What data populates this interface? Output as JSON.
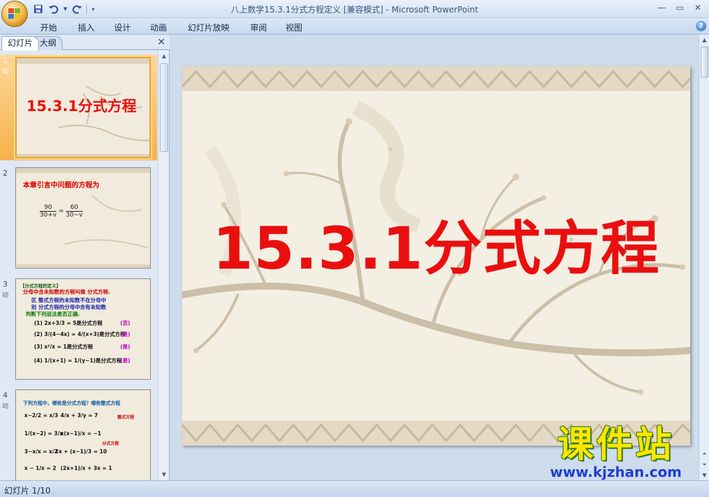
{
  "window": {
    "title": "八上数学15.3.1分式方程定义 [兼容模式]",
    "app_name": "Microsoft PowerPoint",
    "separator": " - "
  },
  "quick_access": {
    "icons": [
      "save-icon",
      "undo-icon",
      "redo-icon",
      "customize-icon"
    ]
  },
  "ribbon": {
    "tabs": [
      "开始",
      "插入",
      "设计",
      "动画",
      "幻灯片放映",
      "审阅",
      "视图"
    ]
  },
  "left_pane": {
    "tabs": [
      "幻灯片",
      "大纲"
    ],
    "close_label": "✕"
  },
  "thumbnails": [
    {
      "number": "1",
      "anim": "动",
      "title": "15.3.1分式方程"
    },
    {
      "number": "2",
      "anim": "",
      "title": "本章引言中问题的方程为",
      "eq_left_num": "90",
      "eq_left_den": "30+v",
      "eq_eq": "=",
      "eq_right_num": "60",
      "eq_right_den": "30−v"
    },
    {
      "number": "3",
      "anim": "动",
      "lines": [
        "【分式方程的定义】",
        "分母中含未知数的方程叫做 分式方程.",
        "区 整式方程的未知数不在分母中",
        "别 分式方程的分母中含有未知数",
        "判断下列说法是否正确.",
        "(1)  2x+3/3 = 5是分式方程",
        "(2)  3/(4−4x) = 4/(x+3)是分式方程",
        "(3)  x²/x = 1是分式方程",
        "(4)  1/(x+1) = 1/(y−1)是分式方程"
      ],
      "answers": [
        "(否)",
        "(是)",
        "(是)",
        "(是)"
      ]
    },
    {
      "number": "4",
      "anim": "动",
      "lines": [
        "下列方程中，哪些是分式方程？哪些整式方程",
        "x−2/2 = x/3",
        "4/x + 3/y = 7",
        "1/(x−2) = 3/x",
        "x(x−1)/x = −1",
        "3−x/x = x/2",
        "2x + (x−1)/3 = 10",
        "x − 1/x = 2",
        "(2x+1)/x + 3x = 1"
      ],
      "tags": [
        "整式方程",
        "分式方程"
      ]
    }
  ],
  "slide": {
    "title": "15.3.1分式方程"
  },
  "status": {
    "slide_indicator": "幻灯片 1/10"
  },
  "watermark": {
    "big": "课件站",
    "small": "www.kjzhan.com"
  },
  "colors": {
    "title_red": "#ea0f0f",
    "ribbon_blue": "#c7d8ee",
    "slide_bg": "#f3efe3",
    "selected_thumb": "#f7b14a"
  }
}
